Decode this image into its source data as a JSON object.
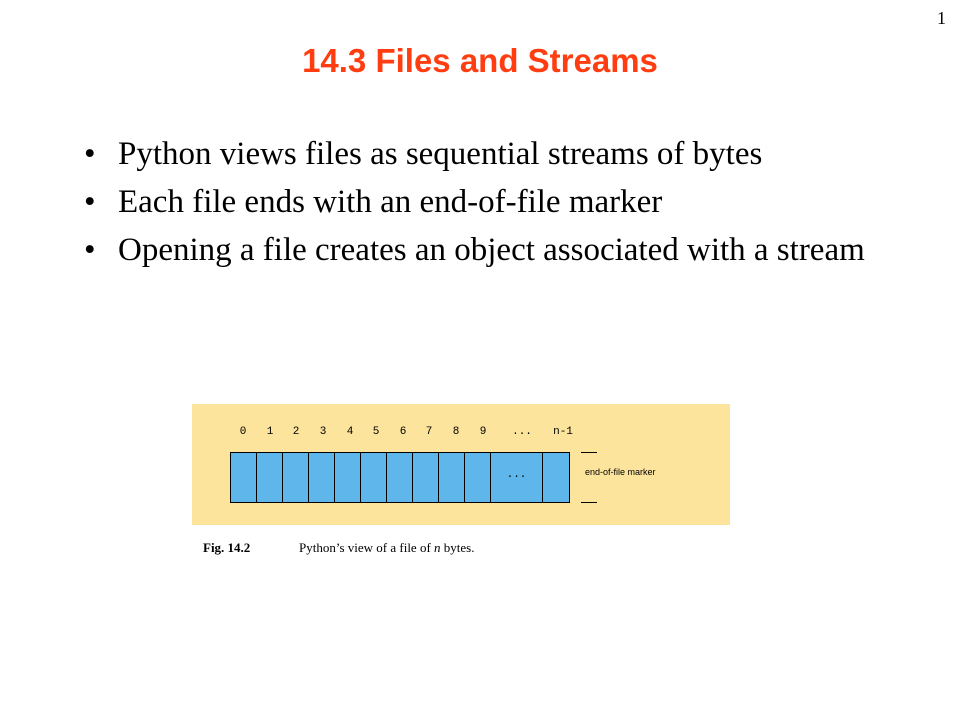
{
  "page_number": "1",
  "title": "14.3 Files and Streams",
  "bullet_glyph": "•",
  "bullets": [
    "Python views files as sequential streams of bytes",
    "Each file ends with an end-of-file marker",
    "Opening a file creates an object associated with a stream"
  ],
  "figure": {
    "indices": [
      "0",
      "1",
      "2",
      "3",
      "4",
      "5",
      "6",
      "7",
      "8",
      "9",
      "...",
      "n-1"
    ],
    "cell_ellipsis": "...",
    "eof_label": "end-of-file marker",
    "panel_color": "#fde49c",
    "cell_color": "#5fb6ea"
  },
  "caption": {
    "label": "Fig. 14.2",
    "text_before": "Python’s view of a file of ",
    "text_italic": "n",
    "text_after": " bytes."
  },
  "colors": {
    "title": "#ff3d10"
  }
}
